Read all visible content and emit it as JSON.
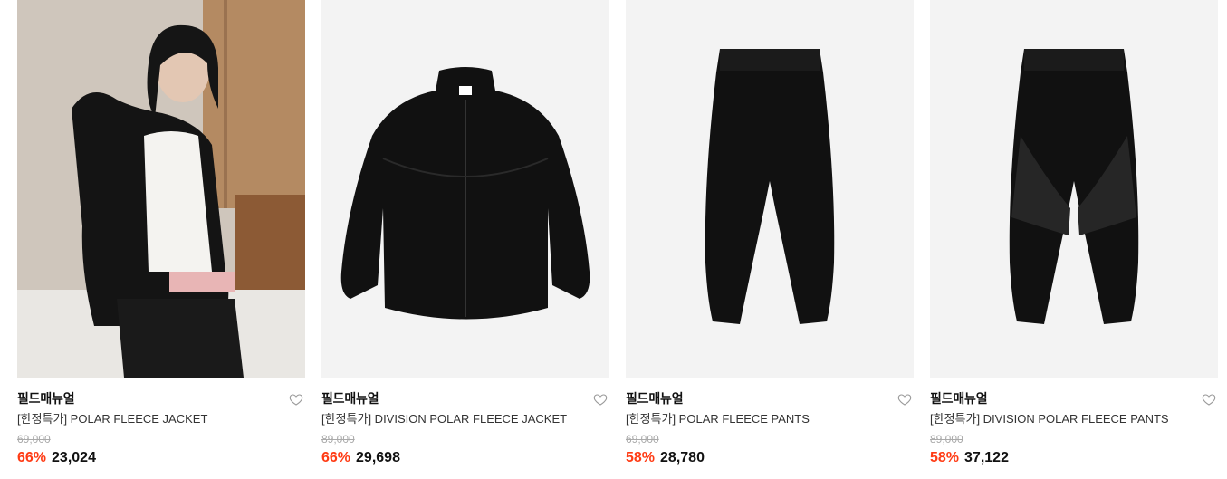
{
  "products": [
    {
      "brand": "필드매뉴얼",
      "title": "[한정특가] POLAR FLEECE JACKET",
      "original_price": "69,000",
      "discount": "66%",
      "price": "23,024",
      "image": "model-wearing-black-fleece-jacket",
      "wishlisted": false
    },
    {
      "brand": "필드매뉴얼",
      "title": "[한정특가] DIVISION POLAR FLEECE JACKET",
      "original_price": "89,000",
      "discount": "66%",
      "price": "29,698",
      "image": "black-fleece-zip-jacket",
      "wishlisted": false
    },
    {
      "brand": "필드매뉴얼",
      "title": "[한정특가] POLAR FLEECE PANTS",
      "original_price": "69,000",
      "discount": "58%",
      "price": "28,780",
      "image": "black-fleece-jogger-pants",
      "wishlisted": false
    },
    {
      "brand": "필드매뉴얼",
      "title": "[한정특가] DIVISION POLAR FLEECE PANTS",
      "original_price": "89,000",
      "discount": "58%",
      "price": "37,122",
      "image": "black-paneled-fleece-pants",
      "wishlisted": false
    }
  ],
  "colors": {
    "discount": "#ff3b14",
    "strike": "#aaaaaa",
    "thumb_bg": "#f3f3f3"
  },
  "icons": {
    "wishlist": "heart-outline-icon"
  }
}
